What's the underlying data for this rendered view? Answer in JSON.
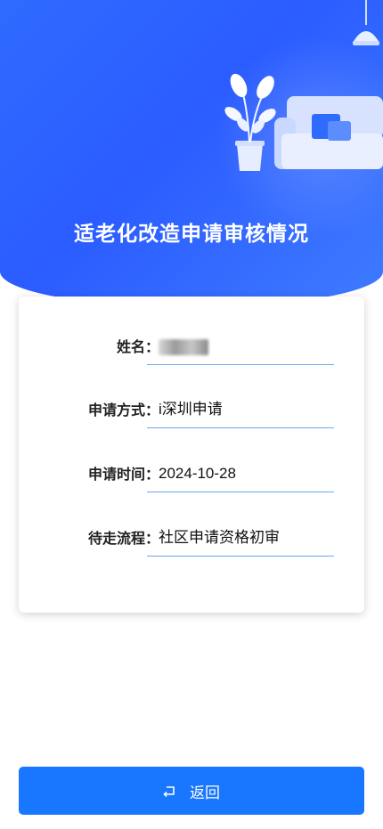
{
  "header": {
    "title": "适老化改造申请审核情况"
  },
  "form": {
    "rows": [
      {
        "label": "姓名：",
        "value": "",
        "masked": true
      },
      {
        "label": "申请方式：",
        "value": "i深圳申请"
      },
      {
        "label": "申请时间：",
        "value": "2024-10-28"
      },
      {
        "label": "待走流程：",
        "value": "社区申请资格初审"
      }
    ]
  },
  "footer": {
    "back_label": "返回",
    "back_icon": "return-icon"
  },
  "colors": {
    "accent": "#1976ff",
    "hero": "#2f6bff",
    "underline": "#6aaaf0"
  }
}
